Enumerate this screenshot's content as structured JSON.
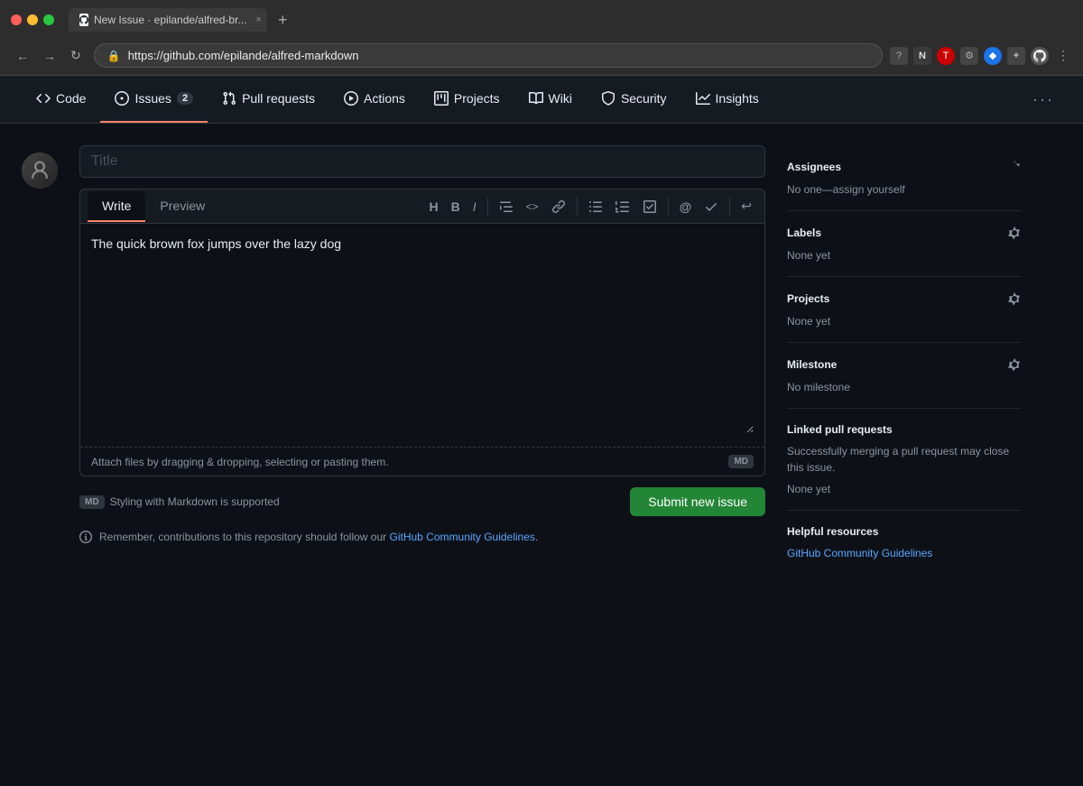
{
  "browser": {
    "traffic_lights": [
      "red",
      "yellow",
      "green"
    ],
    "tab_label": "New Issue · epilande/alfred-br...",
    "tab_close": "×",
    "tab_new": "+",
    "nav_back": "←",
    "nav_forward": "→",
    "nav_refresh": "↻",
    "address_url": "https://github.com/epilande/alfred-markdown",
    "address_lock": "🔒"
  },
  "repo_nav": {
    "items": [
      {
        "id": "code",
        "label": "Code",
        "icon": "code",
        "badge": null,
        "active": false
      },
      {
        "id": "issues",
        "label": "Issues",
        "icon": "circle-dot",
        "badge": "2",
        "active": true
      },
      {
        "id": "pull-requests",
        "label": "Pull requests",
        "icon": "git-pull-request",
        "badge": null,
        "active": false
      },
      {
        "id": "actions",
        "label": "Actions",
        "icon": "play",
        "badge": null,
        "active": false
      },
      {
        "id": "projects",
        "label": "Projects",
        "icon": "table",
        "badge": null,
        "active": false
      },
      {
        "id": "wiki",
        "label": "Wiki",
        "icon": "book",
        "badge": null,
        "active": false
      },
      {
        "id": "security",
        "label": "Security",
        "icon": "shield",
        "badge": null,
        "active": false
      },
      {
        "id": "insights",
        "label": "Insights",
        "icon": "graph",
        "badge": null,
        "active": false
      }
    ],
    "more": "···"
  },
  "issue_form": {
    "title_placeholder": "Title",
    "editor_tabs": [
      {
        "id": "write",
        "label": "Write",
        "active": true
      },
      {
        "id": "preview",
        "label": "Preview",
        "active": false
      }
    ],
    "editor_content": "The quick brown fox jumps over the lazy dog",
    "toolbar_buttons": [
      {
        "id": "heading",
        "icon": "H",
        "title": "Heading"
      },
      {
        "id": "bold",
        "icon": "B",
        "title": "Bold"
      },
      {
        "id": "italic",
        "icon": "I",
        "title": "Italic"
      },
      {
        "id": "quote",
        "icon": "❝",
        "title": "Quote"
      },
      {
        "id": "code",
        "icon": "<>",
        "title": "Code"
      },
      {
        "id": "link",
        "icon": "🔗",
        "title": "Link"
      },
      {
        "id": "unordered-list",
        "icon": "≡",
        "title": "Unordered list"
      },
      {
        "id": "ordered-list",
        "icon": "1≡",
        "title": "Ordered list"
      },
      {
        "id": "task-list",
        "icon": "☑",
        "title": "Task list"
      },
      {
        "id": "mention",
        "icon": "@",
        "title": "Mention"
      },
      {
        "id": "reference",
        "icon": "↗",
        "title": "Reference"
      },
      {
        "id": "undo",
        "icon": "↩",
        "title": "Undo"
      }
    ],
    "file_attach_text": "Attach files by dragging & dropping, selecting or pasting them.",
    "md_badge": "MD",
    "md_support_text": "Styling with Markdown is supported",
    "submit_button": "Submit new issue",
    "community_notice_prefix": "Remember, contributions to this repository should follow our ",
    "community_link_text": "GitHub Community Guidelines",
    "community_notice_suffix": ".",
    "community_link_url": "#"
  },
  "sidebar": {
    "sections": [
      {
        "id": "assignees",
        "title": "Assignees",
        "gear": true,
        "value": "No one—assign yourself",
        "value_type": "text"
      },
      {
        "id": "labels",
        "title": "Labels",
        "gear": true,
        "value": "None yet",
        "value_type": "text"
      },
      {
        "id": "projects",
        "title": "Projects",
        "gear": true,
        "value": "None yet",
        "value_type": "text"
      },
      {
        "id": "milestone",
        "title": "Milestone",
        "gear": true,
        "value": "No milestone",
        "value_type": "text"
      },
      {
        "id": "linked-prs",
        "title": "Linked pull requests",
        "gear": false,
        "description": "Successfully merging a pull request may close this issue.",
        "value": "None yet",
        "value_type": "text"
      },
      {
        "id": "helpful-resources",
        "title": "Helpful resources",
        "gear": false,
        "link_text": "GitHub Community Guidelines",
        "link_url": "#",
        "value_type": "link"
      }
    ]
  }
}
